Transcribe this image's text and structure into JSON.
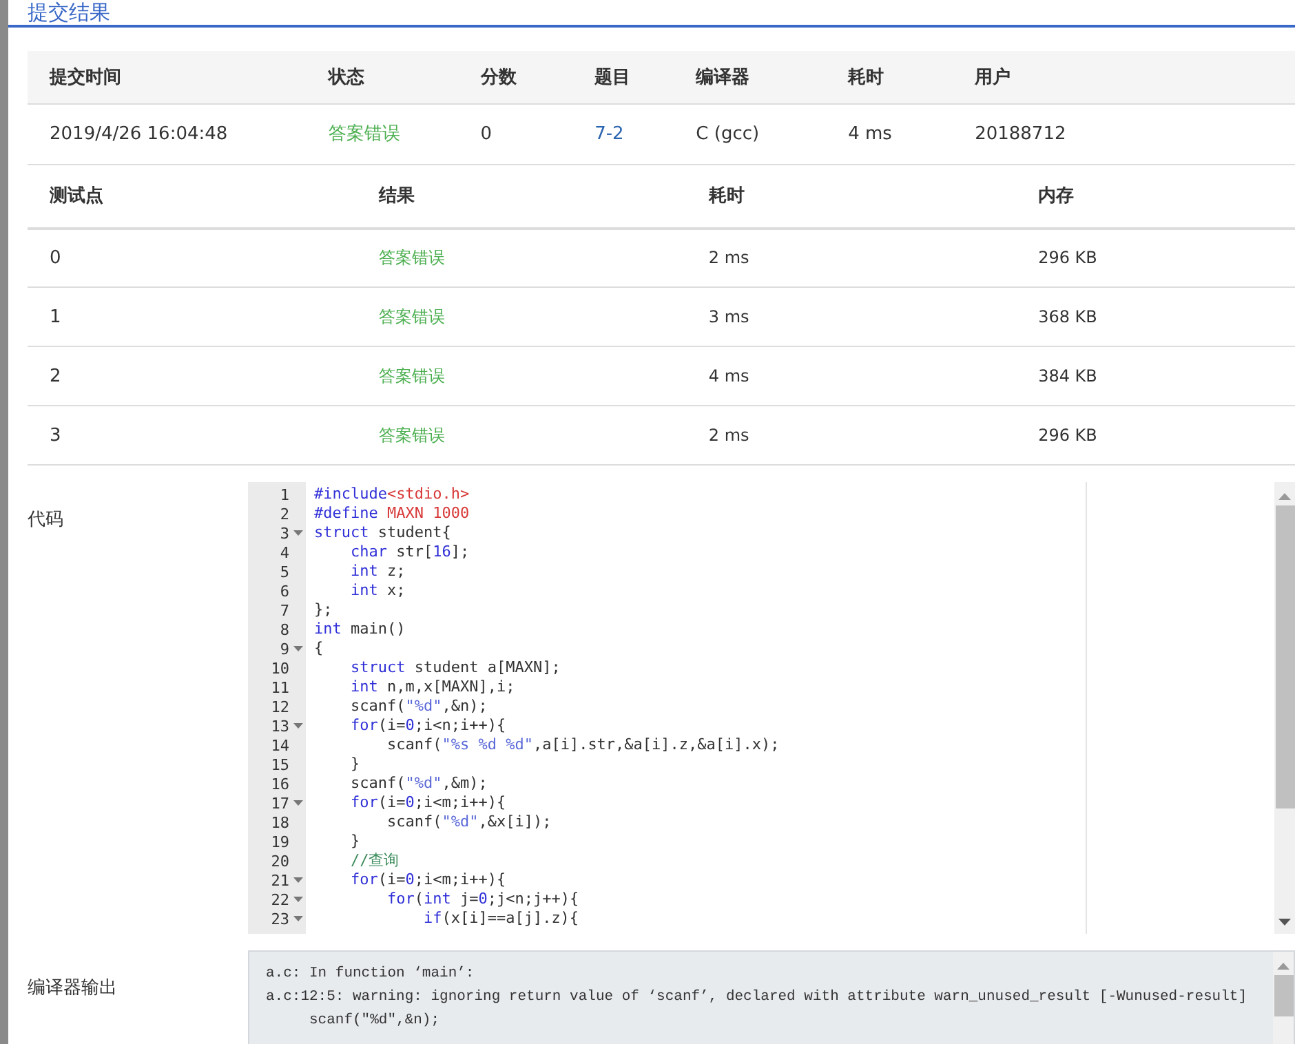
{
  "window": {
    "title": "提交结果"
  },
  "submission": {
    "columns": [
      "提交时间",
      "状态",
      "分数",
      "题目",
      "编译器",
      "耗时",
      "用户"
    ],
    "row": {
      "time": "2019/4/26 16:04:48",
      "status": "答案错误",
      "score": "0",
      "problem": "7-2",
      "compiler": "C (gcc)",
      "duration": "4 ms",
      "user": "20188712"
    }
  },
  "tests": {
    "columns": [
      "测试点",
      "结果",
      "耗时",
      "内存"
    ],
    "rows": [
      {
        "case": "0",
        "result": "答案错误",
        "duration": "2 ms",
        "memory": "296 KB"
      },
      {
        "case": "1",
        "result": "答案错误",
        "duration": "3 ms",
        "memory": "368 KB"
      },
      {
        "case": "2",
        "result": "答案错误",
        "duration": "4 ms",
        "memory": "384 KB"
      },
      {
        "case": "3",
        "result": "答案错误",
        "duration": "2 ms",
        "memory": "296 KB"
      }
    ]
  },
  "code": {
    "label": "代码",
    "lines": [
      {
        "number": "1",
        "fold": false,
        "tokens": [
          {
            "kind": "kw",
            "text": "#include"
          },
          {
            "kind": "red",
            "text": "<stdio.h>"
          }
        ]
      },
      {
        "number": "2",
        "fold": false,
        "tokens": [
          {
            "kind": "kw",
            "text": "#define"
          },
          {
            "kind": "red",
            "text": " MAXN 1000"
          }
        ]
      },
      {
        "number": "3",
        "fold": true,
        "tokens": [
          {
            "kind": "kw",
            "text": "struct"
          },
          {
            "kind": "plain",
            "text": " student{"
          }
        ]
      },
      {
        "number": "4",
        "fold": false,
        "tokens": [
          {
            "kind": "kw",
            "text": "    char"
          },
          {
            "kind": "plain",
            "text": " str["
          },
          {
            "kind": "num",
            "text": "16"
          },
          {
            "kind": "plain",
            "text": "];"
          }
        ]
      },
      {
        "number": "5",
        "fold": false,
        "tokens": [
          {
            "kind": "kw",
            "text": "    int"
          },
          {
            "kind": "plain",
            "text": " z;"
          }
        ]
      },
      {
        "number": "6",
        "fold": false,
        "tokens": [
          {
            "kind": "kw",
            "text": "    int"
          },
          {
            "kind": "plain",
            "text": " x;"
          }
        ]
      },
      {
        "number": "7",
        "fold": false,
        "tokens": [
          {
            "kind": "plain",
            "text": "};"
          }
        ]
      },
      {
        "number": "8",
        "fold": false,
        "tokens": [
          {
            "kind": "kw",
            "text": "int"
          },
          {
            "kind": "plain",
            "text": " main()"
          }
        ]
      },
      {
        "number": "9",
        "fold": true,
        "tokens": [
          {
            "kind": "plain",
            "text": "{"
          }
        ]
      },
      {
        "number": "10",
        "fold": false,
        "tokens": [
          {
            "kind": "kw",
            "text": "    struct"
          },
          {
            "kind": "plain",
            "text": " student a[MAXN];"
          }
        ]
      },
      {
        "number": "11",
        "fold": false,
        "tokens": [
          {
            "kind": "kw",
            "text": "    int"
          },
          {
            "kind": "plain",
            "text": " n,m,x[MAXN],i;"
          }
        ]
      },
      {
        "number": "12",
        "fold": false,
        "tokens": [
          {
            "kind": "plain",
            "text": "    scanf("
          },
          {
            "kind": "str",
            "text": "\"%d\""
          },
          {
            "kind": "plain",
            "text": ",&n);"
          }
        ]
      },
      {
        "number": "13",
        "fold": true,
        "tokens": [
          {
            "kind": "kw",
            "text": "    for"
          },
          {
            "kind": "plain",
            "text": "(i="
          },
          {
            "kind": "num",
            "text": "0"
          },
          {
            "kind": "plain",
            "text": ";i<n;i++){"
          }
        ]
      },
      {
        "number": "14",
        "fold": false,
        "tokens": [
          {
            "kind": "plain",
            "text": "        scanf("
          },
          {
            "kind": "str",
            "text": "\"%s %d %d\""
          },
          {
            "kind": "plain",
            "text": ",a[i].str,&a[i].z,&a[i].x);"
          }
        ]
      },
      {
        "number": "15",
        "fold": false,
        "tokens": [
          {
            "kind": "plain",
            "text": "    }"
          }
        ]
      },
      {
        "number": "16",
        "fold": false,
        "tokens": [
          {
            "kind": "plain",
            "text": "    scanf("
          },
          {
            "kind": "str",
            "text": "\"%d\""
          },
          {
            "kind": "plain",
            "text": ",&m);"
          }
        ]
      },
      {
        "number": "17",
        "fold": true,
        "tokens": [
          {
            "kind": "kw",
            "text": "    for"
          },
          {
            "kind": "plain",
            "text": "(i="
          },
          {
            "kind": "num",
            "text": "0"
          },
          {
            "kind": "plain",
            "text": ";i<m;i++){"
          }
        ]
      },
      {
        "number": "18",
        "fold": false,
        "tokens": [
          {
            "kind": "plain",
            "text": "        scanf("
          },
          {
            "kind": "str",
            "text": "\"%d\""
          },
          {
            "kind": "plain",
            "text": ",&x[i]);"
          }
        ]
      },
      {
        "number": "19",
        "fold": false,
        "tokens": [
          {
            "kind": "plain",
            "text": "    }"
          }
        ]
      },
      {
        "number": "20",
        "fold": false,
        "tokens": [
          {
            "kind": "com",
            "text": "    //查询"
          }
        ]
      },
      {
        "number": "21",
        "fold": true,
        "tokens": [
          {
            "kind": "kw",
            "text": "    for"
          },
          {
            "kind": "plain",
            "text": "(i="
          },
          {
            "kind": "num",
            "text": "0"
          },
          {
            "kind": "plain",
            "text": ";i<m;i++){"
          }
        ]
      },
      {
        "number": "22",
        "fold": true,
        "tokens": [
          {
            "kind": "kw",
            "text": "        for"
          },
          {
            "kind": "plain",
            "text": "("
          },
          {
            "kind": "kw",
            "text": "int"
          },
          {
            "kind": "plain",
            "text": " j="
          },
          {
            "kind": "num",
            "text": "0"
          },
          {
            "kind": "plain",
            "text": ";j<n;j++){"
          }
        ]
      },
      {
        "number": "23",
        "fold": true,
        "tokens": [
          {
            "kind": "kw",
            "text": "            if"
          },
          {
            "kind": "plain",
            "text": "(x[i]==a[j].z){"
          }
        ]
      }
    ]
  },
  "compiler_output": {
    "label": "编译器输出",
    "lines": [
      "a.c: In function ‘main’:",
      "a.c:12:5: warning: ignoring return value of ‘scanf’, declared with attribute warn_unused_result [-Wunused-result]",
      "     scanf(\"%d\",&n);"
    ]
  }
}
